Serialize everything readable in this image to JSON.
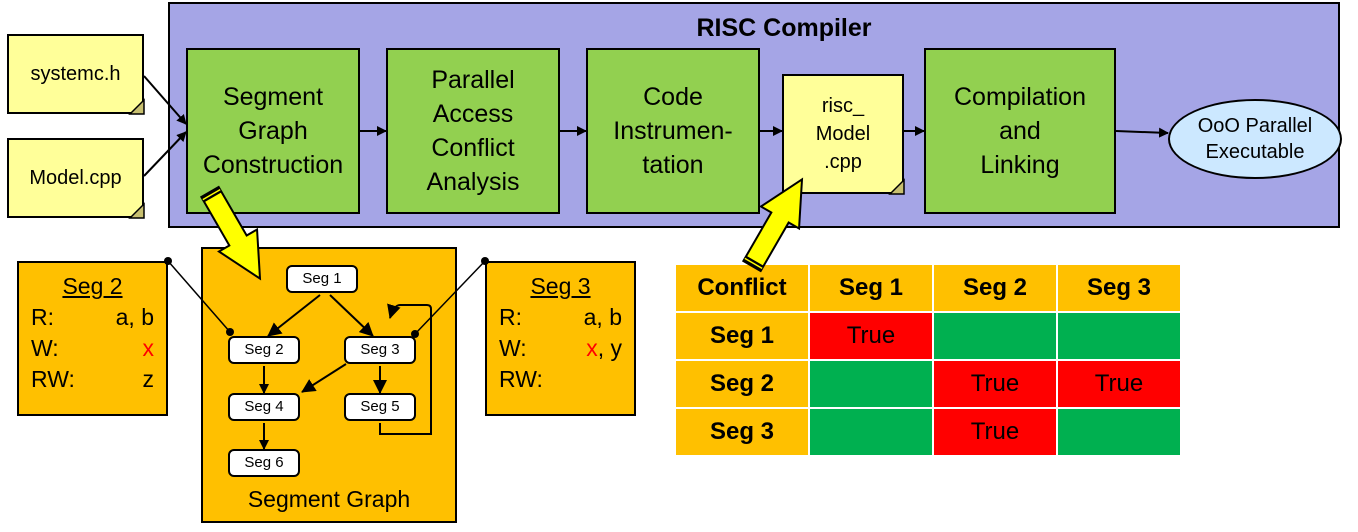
{
  "compiler": {
    "title": "RISC Compiler"
  },
  "inputs": [
    {
      "label": "systemc.h"
    },
    {
      "label": "Model.cpp"
    }
  ],
  "stages": [
    {
      "label": "Segment\nGraph\nConstruction"
    },
    {
      "label": "Parallel\nAccess\nConflict\nAnalysis"
    },
    {
      "label": "Code\nInstrumen-\ntation"
    },
    {
      "label": "risc_\nModel\n.cpp",
      "kind": "file"
    },
    {
      "label": "Compilation\nand\nLinking"
    }
  ],
  "output": {
    "label": "OoO Parallel\nExecutable"
  },
  "segment_graph": {
    "label": "Segment Graph",
    "nodes": [
      "Seg 1",
      "Seg 2",
      "Seg 3",
      "Seg 4",
      "Seg 5",
      "Seg 6"
    ],
    "edges": [
      [
        "Seg 1",
        "Seg 2"
      ],
      [
        "Seg 1",
        "Seg 3"
      ],
      [
        "Seg 2",
        "Seg 4"
      ],
      [
        "Seg 3",
        "Seg 4"
      ],
      [
        "Seg 3",
        "Seg 5"
      ],
      [
        "Seg 5",
        "Seg 3"
      ],
      [
        "Seg 4",
        "Seg 6"
      ]
    ]
  },
  "seg_info": [
    {
      "title": "Seg 2",
      "rows": [
        {
          "key": "R:",
          "value": "a, b",
          "highlight": ""
        },
        {
          "key": "W:",
          "value": "",
          "highlight": "x"
        },
        {
          "key": "RW:",
          "value": "z",
          "highlight": ""
        }
      ]
    },
    {
      "title": "Seg 3",
      "rows": [
        {
          "key": "R:",
          "value": "a, b",
          "highlight": ""
        },
        {
          "key": "W:",
          "value": ", y",
          "highlight": "x"
        },
        {
          "key": "RW:",
          "value": "",
          "highlight": ""
        }
      ]
    }
  ],
  "conflict_table": {
    "corner": "Conflict",
    "columns": [
      "Seg 1",
      "Seg 2",
      "Seg 3"
    ],
    "rows": [
      {
        "label": "Seg 1",
        "cells": [
          "True",
          "",
          ""
        ]
      },
      {
        "label": "Seg 2",
        "cells": [
          "",
          "True",
          "True"
        ]
      },
      {
        "label": "Seg 3",
        "cells": [
          "",
          "True",
          ""
        ]
      }
    ],
    "colors": {
      "true": "#ff0000",
      "false": "#00b050",
      "header": "#ffc000"
    }
  }
}
